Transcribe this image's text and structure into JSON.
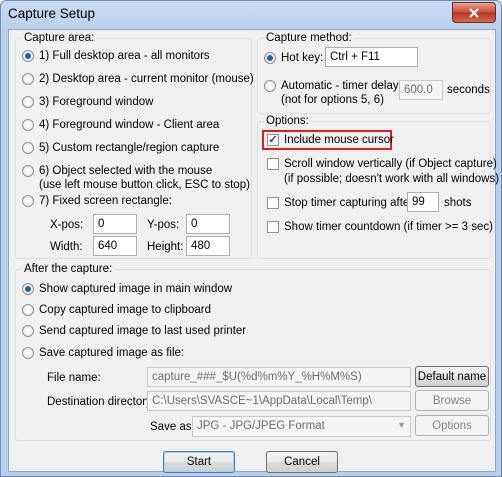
{
  "window": {
    "title": "Capture Setup",
    "close_icon": "✕",
    "colors": {
      "highlight": "#e0201e",
      "close": "#c74c33",
      "radio_dot": "#1f5faa"
    }
  },
  "capture_area": {
    "title": "Capture area:",
    "options": [
      {
        "label": "1) Full desktop area - all monitors",
        "checked": true
      },
      {
        "label": "2) Desktop area - current monitor (mouse)",
        "checked": false
      },
      {
        "label": "3) Foreground window",
        "checked": false
      },
      {
        "label": "4) Foreground window - Client area",
        "checked": false
      },
      {
        "label": "5) Custom rectangle/region capture",
        "checked": false
      },
      {
        "label": "6) Object selected with the mouse",
        "sub": "(use left mouse button click, ESC to stop)",
        "checked": false
      },
      {
        "label": "7) Fixed screen rectangle:",
        "checked": false
      }
    ],
    "fixed_rect": {
      "xpos_label": "X-pos:",
      "xpos": "0",
      "ypos_label": "Y-pos:",
      "ypos": "0",
      "width_label": "Width:",
      "width": "640",
      "height_label": "Height:",
      "height": "480"
    }
  },
  "capture_method": {
    "title": "Capture method:",
    "hotkey_label": "Hot key:",
    "hotkey_value": "Ctrl + F11",
    "auto_label": "Automatic - timer delay:",
    "auto_sub": "(not for options 5, 6)",
    "delay_value": "600.0",
    "seconds_label": "seconds"
  },
  "options": {
    "title": "Options:",
    "include_cursor": "Include mouse cursor",
    "scroll_label": "Scroll window vertically (if Object capture)",
    "scroll_sub": "(if possible; doesn't work with all windows)",
    "stop_timer_label": "Stop timer capturing after:",
    "stop_timer_value": "99",
    "shots_label": "shots",
    "show_countdown": "Show timer countdown (if timer >= 3 sec)"
  },
  "after_capture": {
    "title": "After the capture:",
    "options": [
      {
        "label": "Show captured image in main window",
        "checked": true
      },
      {
        "label": "Copy captured image to clipboard",
        "checked": false
      },
      {
        "label": "Send captured image to last used printer",
        "checked": false
      },
      {
        "label": "Save captured image as file:",
        "checked": false
      }
    ],
    "file_name_label": "File name:",
    "file_name_value": "capture_###_$U(%d%m%Y_%H%M%S)",
    "default_name_button": "Default name",
    "dest_dir_label": "Destination directory:",
    "dest_dir_value": "C:\\Users\\SVASCE~1\\AppData\\Local\\Temp\\",
    "browse_button": "Browse",
    "save_as_label": "Save as:",
    "save_as_value": "JPG - JPG/JPEG Format",
    "options_button": "Options"
  },
  "footer": {
    "start_button": "Start",
    "cancel_button": "Cancel"
  }
}
